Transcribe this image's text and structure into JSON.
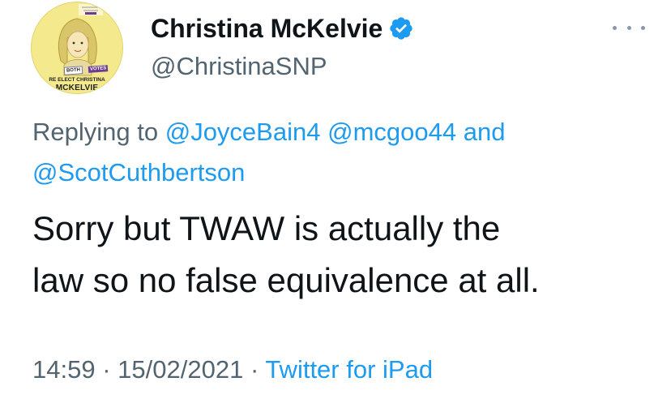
{
  "author": {
    "display_name": "Christina McKelvie",
    "handle": "@ChristinaSNP",
    "verified": true,
    "avatar": {
      "badge_both": "BOTH",
      "badge_votes": "VOTES",
      "reelect_text": "RE ELECT CHRISTINA",
      "name_text": "MCKELVIE"
    }
  },
  "reply": {
    "prefix": "Replying to",
    "mentions": [
      "@JoyceBain4",
      "@mcgoo44",
      "@ScotCuthbertson"
    ],
    "conjunction": "and"
  },
  "tweet": {
    "line1": "Sorry but TWAW is actually the",
    "line2": "law so no false equivalence at all."
  },
  "meta": {
    "time": "14:59",
    "separator": "·",
    "date": "15/02/2021",
    "source": "Twitter for iPad"
  },
  "colors": {
    "accent": "#1d9bf0",
    "secondary_text": "#536471",
    "primary_text": "#0f1419",
    "avatar_bg": "#f4e98c"
  },
  "icons": {
    "verified": "verified-badge-icon",
    "more": "more-options-icon"
  }
}
